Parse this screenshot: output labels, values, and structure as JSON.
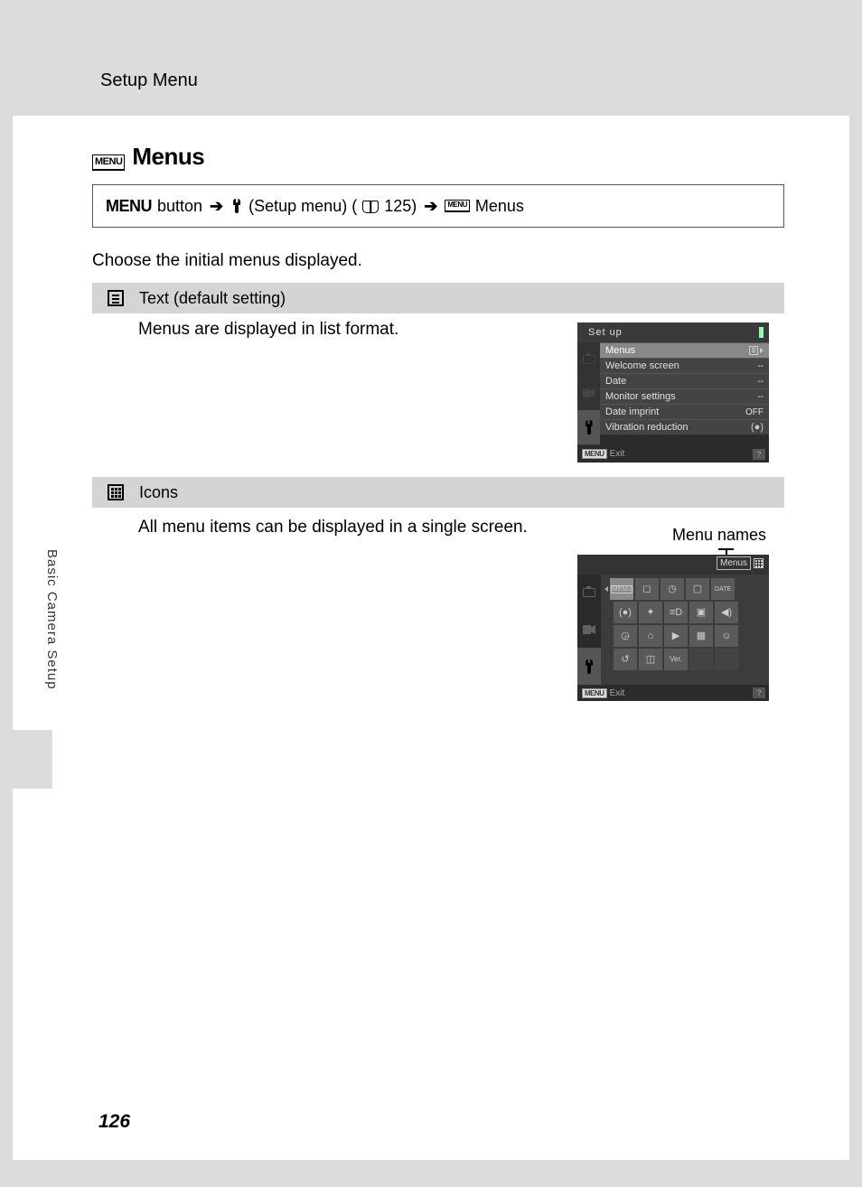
{
  "header": {
    "section": "Setup Menu"
  },
  "title": "Menus",
  "path": {
    "menu_button": "MENU",
    "button_word": "button",
    "setup_menu": "(Setup menu) (",
    "page_ref": "125)",
    "target": "Menus"
  },
  "intro": "Choose the initial menus displayed.",
  "options": {
    "text": {
      "title": "Text (default setting)",
      "body": "Menus are displayed in list format."
    },
    "icons": {
      "title": "Icons",
      "body": "All menu items can be displayed in a single screen."
    }
  },
  "cam_list": {
    "title": "Set up",
    "rows": [
      {
        "label": "Menus",
        "value": ""
      },
      {
        "label": "Welcome screen",
        "value": "--"
      },
      {
        "label": "Date",
        "value": "--"
      },
      {
        "label": "Monitor settings",
        "value": "--"
      },
      {
        "label": "Date imprint",
        "value": "OFF"
      },
      {
        "label": "Vibration reduction",
        "value": ""
      }
    ],
    "exit": "Exit"
  },
  "menu_names_label": "Menu names",
  "cam_grid": {
    "label": "Menus",
    "ver_text": "Ver.",
    "exit": "Exit"
  },
  "side_tab": "Basic Camera Setup",
  "page_number": "126"
}
